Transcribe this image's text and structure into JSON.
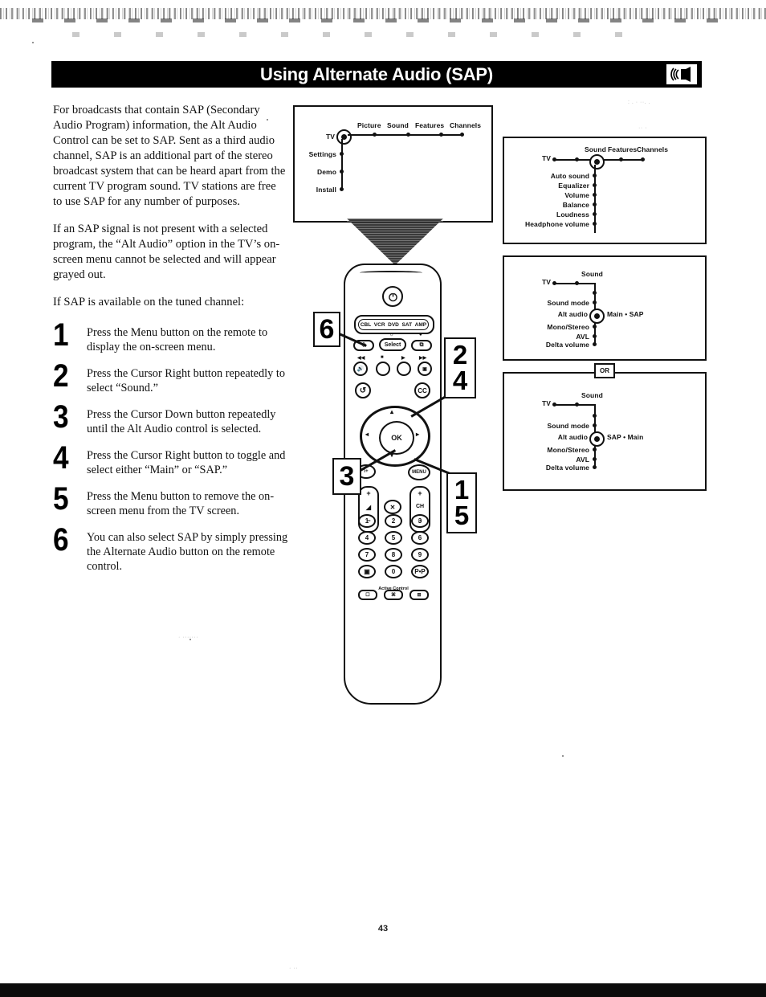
{
  "header": {
    "title": "Using Alternate Audio (SAP)",
    "icon": "speaker-sound-icon"
  },
  "intro": {
    "paragraphs": [
      "For broadcasts that contain SAP (Secondary Audio Program) information, the Alt Audio Control can be set to SAP. Sent as a third audio channel, SAP is an additional part of the stereo broadcast system that can be heard apart from the current TV program sound. TV stations are free to use SAP for any number of purposes.",
      "If an SAP signal is not present with a selected program, the “Alt Audio” option in the TV’s on-screen menu cannot be selected and will appear grayed out.",
      "If SAP is available on the tuned channel:"
    ]
  },
  "steps": [
    {
      "number": "1",
      "text": "Press the Menu button on the remote to display the on-screen menu."
    },
    {
      "number": "2",
      "text": "Press the Cursor Right button repeatedly to select “Sound.”"
    },
    {
      "number": "3",
      "text": "Press the Cursor Down button repeatedly until the Alt Audio control is selected."
    },
    {
      "number": "4",
      "text": "Press the Cursor Right button to toggle and select either “Main” or “SAP.”"
    },
    {
      "number": "5",
      "text": "Press the Menu button to remove the on-screen menu from the TV screen."
    },
    {
      "number": "6",
      "text": "You can also select SAP by simply pressing the Alternate Audio button on the remote control."
    }
  ],
  "tv_screen_menu": {
    "root_label": "TV",
    "horizontal_items": [
      "Picture",
      "Sound",
      "Features",
      "Channels"
    ],
    "vertical_items": [
      "Settings",
      "Demo",
      "Install"
    ],
    "cursor_on": "TV"
  },
  "panels": [
    {
      "id": "sound-menu-panel",
      "root_label": "TV",
      "horizontal_items": [
        "Sound",
        "Features",
        "Channels"
      ],
      "vertical_items": [
        "Auto sound",
        "Equalizer",
        "Volume",
        "Balance",
        "Loudness",
        "Headphone volume"
      ],
      "cursor_on": "Sound"
    },
    {
      "id": "alt-audio-main-panel",
      "root_label": "TV",
      "column_header": "Sound",
      "vertical_items": [
        "Sound mode",
        "Alt audio",
        "Mono/Stereo",
        "AVL",
        "Delta volume"
      ],
      "cursor_on": "Alt audio",
      "value_text": "Main • SAP"
    },
    {
      "id": "alt-audio-sap-panel",
      "root_label": "TV",
      "column_header": "Sound",
      "vertical_items": [
        "Sound mode",
        "Alt audio",
        "Mono/Stereo",
        "AVL",
        "Delta volume"
      ],
      "cursor_on": "Alt audio",
      "value_text": "SAP • Main"
    }
  ],
  "or_badge": "OR",
  "remote": {
    "power_icon": "power-icon",
    "device_modes": [
      "CBL",
      "VCR",
      "DVD",
      "SAT",
      "AMP"
    ],
    "select_label": "Select",
    "ok_label": "OK",
    "menu_label": "MENU",
    "volume_label": "◢",
    "channel_label": "CH",
    "mute_label": "✕",
    "cc_label": "CC",
    "plus": "+",
    "minus": "−",
    "keypad": [
      [
        "1",
        "2",
        "3"
      ],
      [
        "4",
        "5",
        "6"
      ],
      [
        "7",
        "8",
        "9"
      ],
      [
        "▣",
        "0",
        "P•P"
      ]
    ],
    "active_control_label": "Active Control",
    "bottom_buttons": [
      "☐",
      "⌘",
      "⊞"
    ],
    "icon_names": [
      "power-icon",
      "select-icon",
      "ok-button",
      "menu-button",
      "mute-icon",
      "cc-icon",
      "surround-icon",
      "alt-audio-icon",
      "volume-rocker",
      "channel-rocker"
    ]
  },
  "callouts": [
    {
      "id": "callout-6",
      "label": "6"
    },
    {
      "id": "callout-2-4",
      "labels": [
        "2",
        "4"
      ]
    },
    {
      "id": "callout-3",
      "label": "3"
    },
    {
      "id": "callout-1-5",
      "labels": [
        "1",
        "5"
      ]
    }
  ],
  "footer": {
    "page_number": "43"
  }
}
